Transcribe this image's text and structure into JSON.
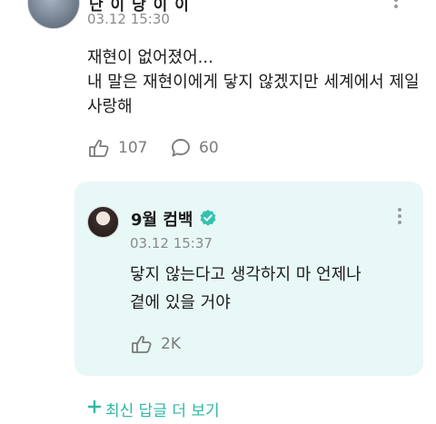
{
  "post": {
    "author_visible": "단 이 당 이 이",
    "date": "03.12 15:30",
    "text": "재현이 없어졌어...\n내 말은 재현이에게 닿지 않겠지만 세계에서 제일 사랑해",
    "likes": "107",
    "comments": "60"
  },
  "reply": {
    "author": "9월 컴백",
    "date": "03.12 15:37",
    "text": "닿지 않는다고 생각하지 마 언제나\n곁에 있을 거야",
    "likes": "2K"
  },
  "more_replies_label": "최신 답글 더 보기",
  "colors": {
    "accent": "#2fb8a5",
    "reply_bg": "#e8f8f6",
    "verified": "#33c2b0"
  },
  "icons": [
    "like-icon",
    "comment-icon",
    "verified-badge-icon",
    "kebab-menu-icon",
    "plus-icon"
  ]
}
